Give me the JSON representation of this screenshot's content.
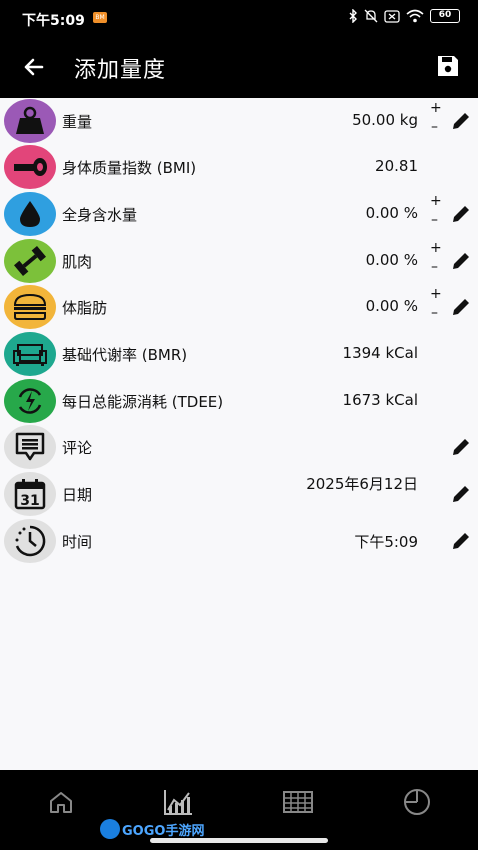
{
  "status_bar": {
    "time": "下午5:09",
    "notif_badge": "BM",
    "battery": "60",
    "icons": [
      "bluetooth-icon",
      "mute-icon",
      "close-box-icon",
      "wifi-icon",
      "battery-icon"
    ]
  },
  "app_bar": {
    "title": "添加量度",
    "back_icon": "arrow-back-icon",
    "save_icon": "save-icon"
  },
  "rows": [
    {
      "label": "重量",
      "value": "50.00 kg",
      "icon": "weight-icon",
      "color": "#9b59b6",
      "stepper": true,
      "editable": true
    },
    {
      "label": "身体质量指数 (BMI)",
      "value": "20.81",
      "icon": "tape-icon",
      "color": "#e2457a",
      "stepper": false,
      "editable": false
    },
    {
      "label": "全身含水量",
      "value": "0.00 %",
      "icon": "drop-icon",
      "color": "#2f9fe0",
      "stepper": true,
      "editable": true
    },
    {
      "label": "肌肉",
      "value": "0.00 %",
      "icon": "dumbbell-icon",
      "color": "#7cc13a",
      "stepper": true,
      "editable": true
    },
    {
      "label": "体脂肪",
      "value": "0.00 %",
      "icon": "burger-icon",
      "color": "#f2b53a",
      "stepper": true,
      "editable": true
    },
    {
      "label": "基础代谢率 (BMR)",
      "value": "1394 kCal",
      "icon": "sofa-icon",
      "color": "#1ea88f",
      "stepper": false,
      "editable": false
    },
    {
      "label": "每日总能源消耗 (TDEE)",
      "value": "1673 kCal",
      "icon": "energy-cycle-icon",
      "color": "#27a84a",
      "stepper": false,
      "editable": false
    },
    {
      "label": "评论",
      "value": "",
      "icon": "comment-icon",
      "color": "#e0e0e0",
      "stepper": false,
      "editable": true
    },
    {
      "label": "日期",
      "value": "2025年6月12日",
      "icon": "calendar-icon",
      "color": "#e0e0e0",
      "stepper": false,
      "editable": true,
      "calendar_day": "31"
    },
    {
      "label": "时间",
      "value": "下午5:09",
      "icon": "clock-icon",
      "color": "#e0e0e0",
      "stepper": false,
      "editable": true
    }
  ],
  "bottom_nav": [
    {
      "icon": "home-icon"
    },
    {
      "icon": "chart-icon"
    },
    {
      "icon": "table-icon"
    },
    {
      "icon": "pie-chart-icon"
    }
  ],
  "watermark": "GOGO手游网"
}
